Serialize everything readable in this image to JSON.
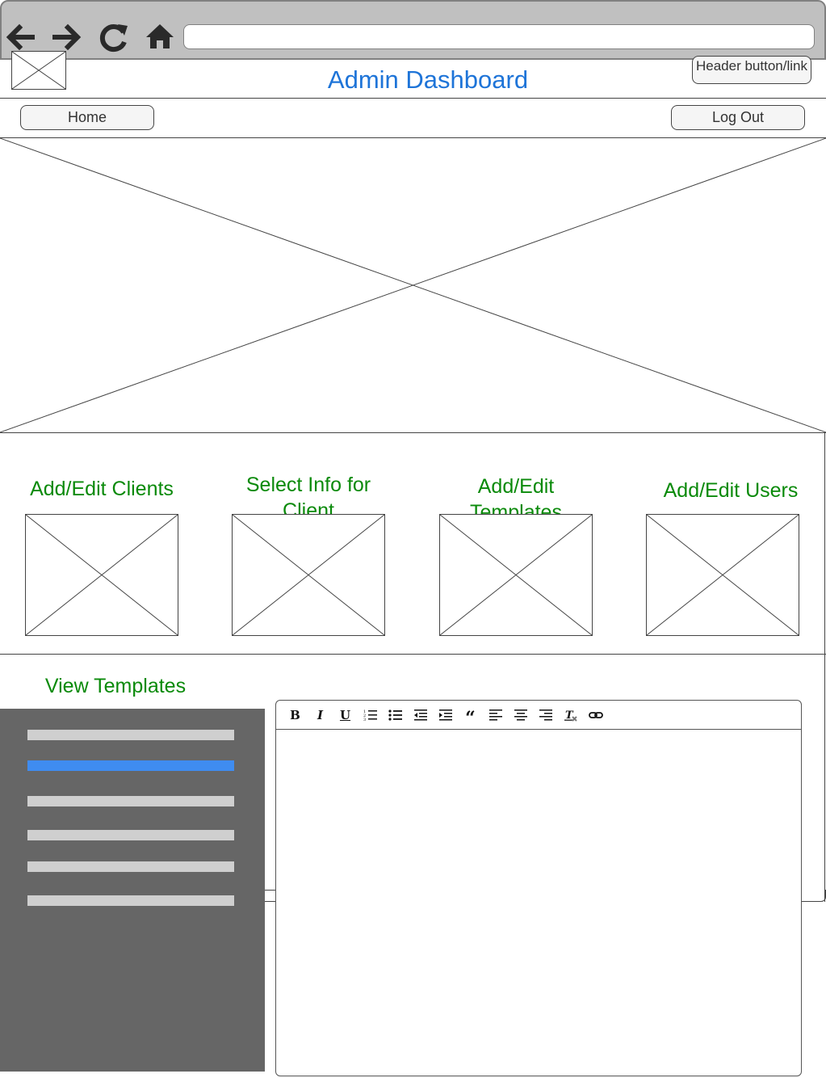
{
  "browser": {
    "url": "",
    "nav_icons": [
      "back-arrow-icon",
      "forward-arrow-icon",
      "refresh-icon",
      "home-icon"
    ]
  },
  "header": {
    "title": "Admin Dashboard",
    "header_button_label": "Header button/link"
  },
  "nav": {
    "home_label": "Home",
    "logout_label": "Log Out"
  },
  "tiles": [
    {
      "label": "Add/Edit Clients"
    },
    {
      "label": "Select Info for Client"
    },
    {
      "label": "Add/Edit Templates"
    },
    {
      "label": "Add/Edit Users"
    }
  ],
  "templates": {
    "heading": "View Templates",
    "list_item_count_visible": 6,
    "active_index": 1
  },
  "editor": {
    "toolbar": [
      "bold-icon",
      "italic-icon",
      "underline-icon",
      "ordered-list-icon",
      "bullet-list-icon",
      "outdent-icon",
      "indent-icon",
      "blockquote-icon",
      "align-left-icon",
      "align-center-icon",
      "align-right-icon",
      "clear-format-icon",
      "link-icon"
    ]
  },
  "colors": {
    "title": "#1e74d8",
    "section_labels": "#0a8a0a",
    "sidebar_bg": "#666666",
    "sidebar_active": "#3f8cf0"
  }
}
